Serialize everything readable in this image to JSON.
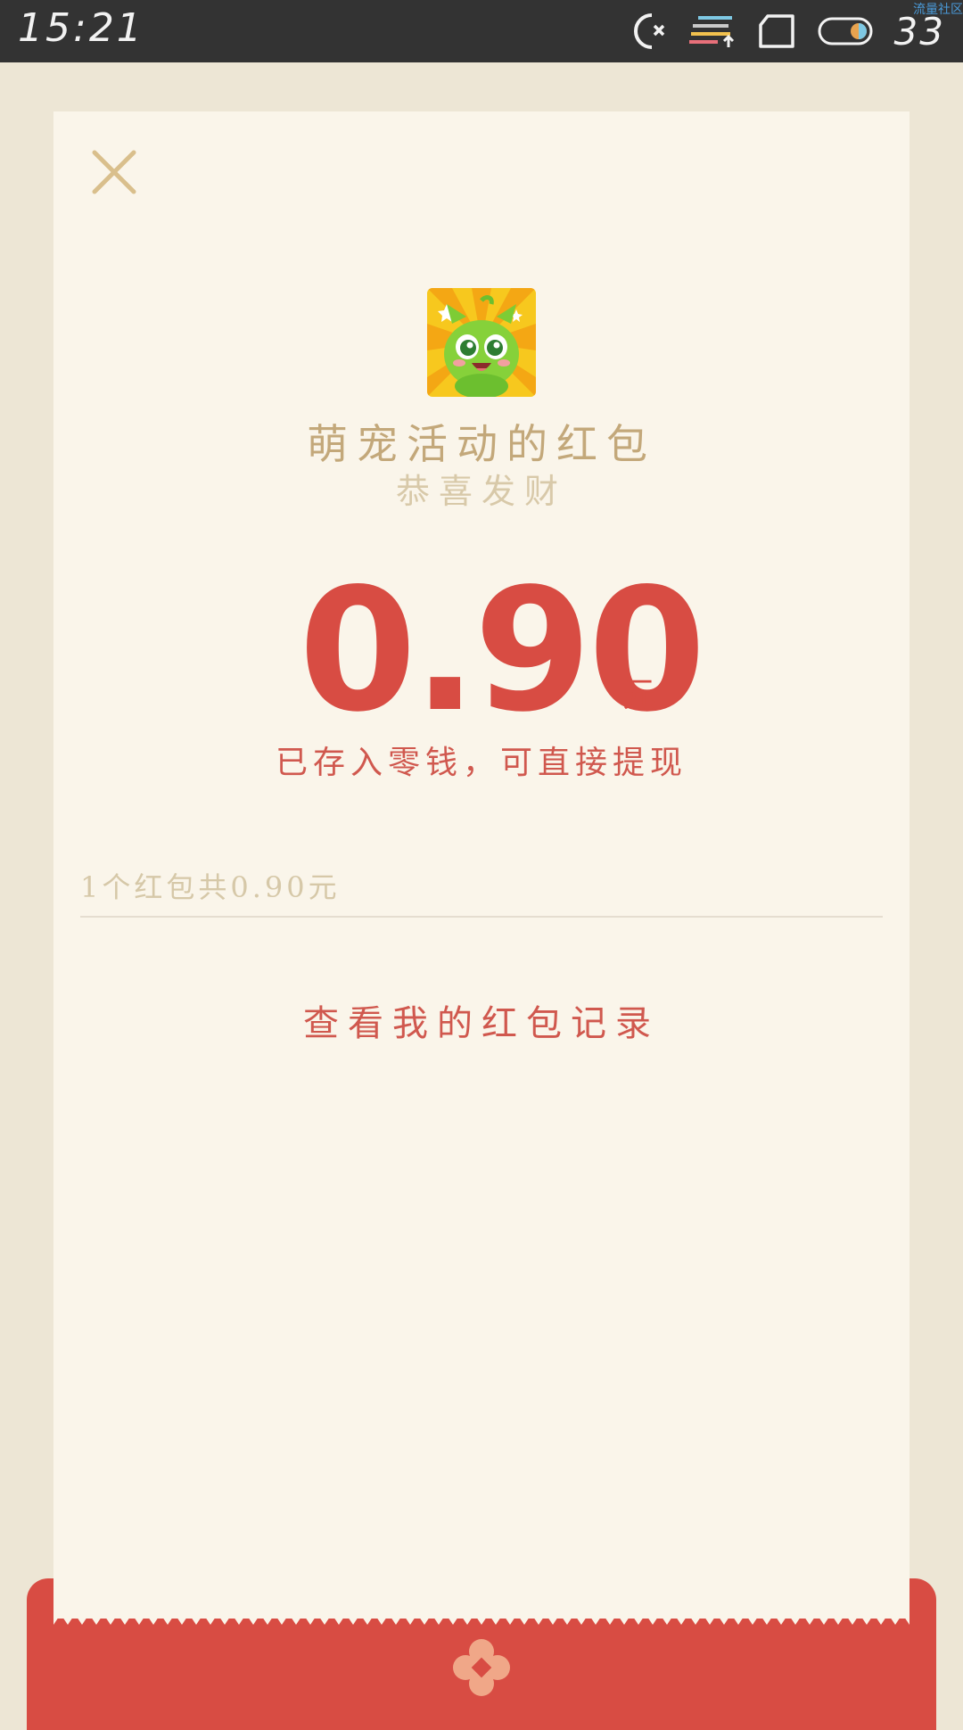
{
  "status_bar": {
    "time": "15:21",
    "battery": "33",
    "icons": [
      "alarm-off-icon",
      "data-transfer-icon",
      "sim-icon",
      "battery-icon"
    ],
    "watermark": "流量社区"
  },
  "red_packet": {
    "sender": "萌宠活动的红包",
    "greeting": "恭喜发财",
    "amount": "0.90",
    "unit": "元",
    "deposit_note": "已存入零钱，可直接提现",
    "summary": "1个红包共0.90元",
    "records_link": "查看我的红包记录"
  },
  "icons": {
    "close": "close-icon",
    "avatar": "pet-avatar-icon",
    "flower": "flower-emblem-icon"
  },
  "colors": {
    "accent_red": "#d84c43",
    "gold": "#c3a87a",
    "card_bg": "#faf5ea",
    "page_bg": "#ede6d5"
  }
}
